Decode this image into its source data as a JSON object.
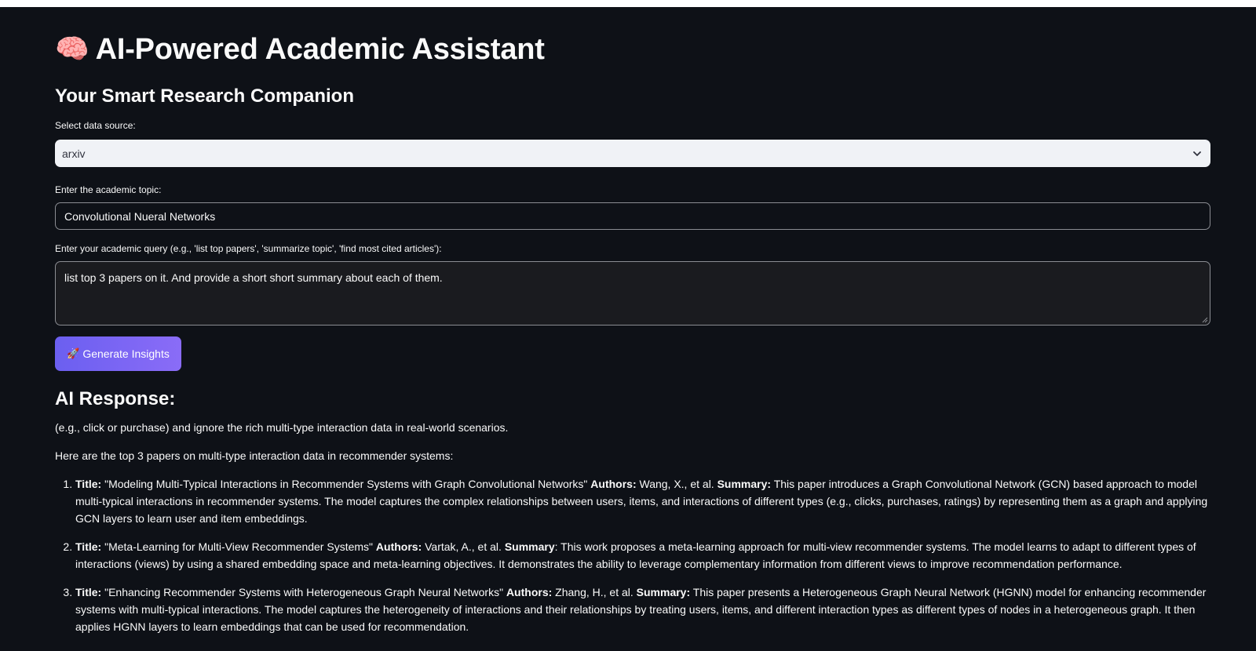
{
  "header": {
    "title_icon": "brain-emoji",
    "title_emoji": "🧠",
    "title": "AI-Powered Academic Assistant",
    "subtitle": "Your Smart Research Companion"
  },
  "form": {
    "source_label": "Select data source:",
    "source_value": "arxiv",
    "topic_label": "Enter the academic topic:",
    "topic_value": "Convolutional Nueral Networks",
    "query_label": "Enter your academic query (e.g., 'list top papers', 'summarize topic', 'find most cited articles'):",
    "query_value": "list top 3 papers on it. And provide a short short summary about each of them.",
    "button_icon": "rocket-emoji",
    "button_emoji": "🚀",
    "button_label": "Generate Insights"
  },
  "response": {
    "heading": "AI Response:",
    "intro_1": "(e.g., click or purchase) and ignore the rich multi-type interaction data in real-world scenarios.",
    "intro_2": "Here are the top 3 papers on multi-type interaction data in recommender systems:",
    "papers": [
      {
        "title_label": "Title:",
        "title": "\"Modeling Multi-Typical Interactions in Recommender Systems with Graph Convolutional Networks\"",
        "authors_label": "Authors:",
        "authors": "Wang, X., et al.",
        "summary_label": "Summary:",
        "summary": "This paper introduces a Graph Convolutional Network (GCN) based approach to model multi-typical interactions in recommender systems. The model captures the complex relationships between users, items, and interactions of different types (e.g., clicks, purchases, ratings) by representing them as a graph and applying GCN layers to learn user and item embeddings."
      },
      {
        "title_label": "Title:",
        "title": "\"Meta-Learning for Multi-View Recommender Systems\"",
        "authors_label": "Authors:",
        "authors": "Vartak, A., et al.",
        "summary_label": "Summary",
        "summary": ": This work proposes a meta-learning approach for multi-view recommender systems. The model learns to adapt to different types of interactions (views) by using a shared embedding space and meta-learning objectives. It demonstrates the ability to leverage complementary information from different views to improve recommendation performance."
      },
      {
        "title_label": "Title:",
        "title": "\"Enhancing Recommender Systems with Heterogeneous Graph Neural Networks\"",
        "authors_label": "Authors:",
        "authors": "Zhang, H., et al.",
        "summary_label": "Summary:",
        "summary": "This paper presents a Heterogeneous Graph Neural Network (HGNN) model for enhancing recommender systems with multi-typical interactions. The model captures the heterogeneity of interactions and their relationships by treating users, items, and different interaction types as different types of nodes in a heterogeneous graph. It then applies HGNN layers to learn embeddings that can be used for recommendation."
      }
    ]
  },
  "colors": {
    "background": "#0e1117",
    "select_bg": "#f0f2f6",
    "button_start": "#6b5ff0",
    "button_end": "#8a6cf7"
  }
}
